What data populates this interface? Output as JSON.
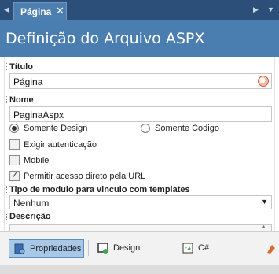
{
  "tab": {
    "label": "Página",
    "close": "✕",
    "nav_left": "◀",
    "nav_right": "▶",
    "nav_down": "▼"
  },
  "header": {
    "title": "Definição do Arquivo ASPX"
  },
  "form": {
    "titulo_label": "Título",
    "titulo_value": "Página",
    "nome_label": "Nome",
    "nome_value": "PaginaAspx",
    "radio_design": "Somente Design",
    "radio_codigo": "Somente Codigo",
    "chk_auth": "Exigir autenticação",
    "chk_mobile": "Mobile",
    "chk_url": "Permitir acesso direto pela URL",
    "tipo_label": "Tipo de modulo para vinculo com templates",
    "tipo_value": "Nenhum",
    "descricao_label": "Descrição"
  },
  "toolbar": {
    "propriedades": "Propriedades",
    "design": "Design",
    "csharp": "C#",
    "csharp_icon_text": "c#"
  },
  "colors": {
    "accent": "#4a7db0",
    "tab_strip": "#2b4f78",
    "active_button": "#a8c8e8"
  }
}
